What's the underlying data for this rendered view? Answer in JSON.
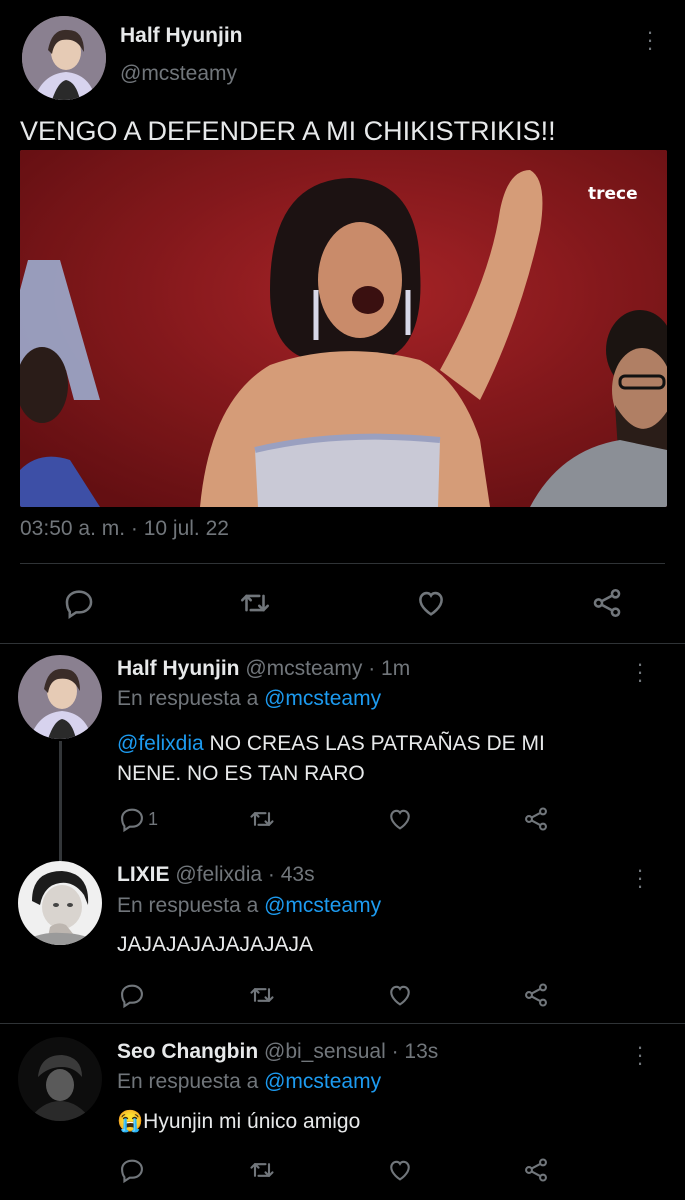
{
  "main_tweet": {
    "author_name": "Half Hyunjin",
    "author_handle": "@mcsteamy",
    "text": "VENGO A DEFENDER A MI CHIKISTRIKIS!!",
    "video_watermark": "trece",
    "timestamp": "03:50 a. m. · 10 jul. 22",
    "actions": [
      "reply-icon",
      "retweet-icon",
      "like-icon",
      "share-icon"
    ]
  },
  "replies": [
    {
      "name": "Half Hyunjin",
      "handle_time": "@mcsteamy · 1m",
      "reply_prefix": "En respuesta a",
      "reply_to": "@mcsteamy",
      "mention": "@felixdia",
      "text_line1": " NO CREAS LAS PATRAÑAS DE MI",
      "text_line2": "NENE. NO ES TAN RARO",
      "reply_count": "1"
    },
    {
      "name": "LIXIE",
      "handle_time": "@felixdia · 43s",
      "reply_prefix": "En respuesta a",
      "reply_to": "@mcsteamy",
      "text": "JAJAJAJAJAJAJAJA"
    },
    {
      "name": "Seo Changbin",
      "handle_time": "@bi_sensual · 13s",
      "reply_prefix": "En respuesta a",
      "reply_to": "@mcsteamy",
      "emoji": "😭",
      "text": "Hyunjin mi único amigo"
    }
  ],
  "colors": {
    "background": "#000000",
    "text": "#e7e9ea",
    "muted": "#71767b",
    "link": "#1d9bf0",
    "divider": "#2f3336"
  }
}
